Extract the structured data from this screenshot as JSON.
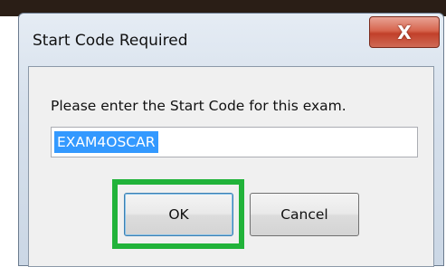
{
  "dialog": {
    "title": "Start Code Required",
    "close_label": "X",
    "prompt": "Please enter the Start Code for this exam.",
    "code_value": "EXAM4OSCAR",
    "ok_label": "OK",
    "cancel_label": "Cancel"
  },
  "colors": {
    "highlight": "#21b33a",
    "selection": "#3399ff",
    "close_button": "#c2402a"
  }
}
